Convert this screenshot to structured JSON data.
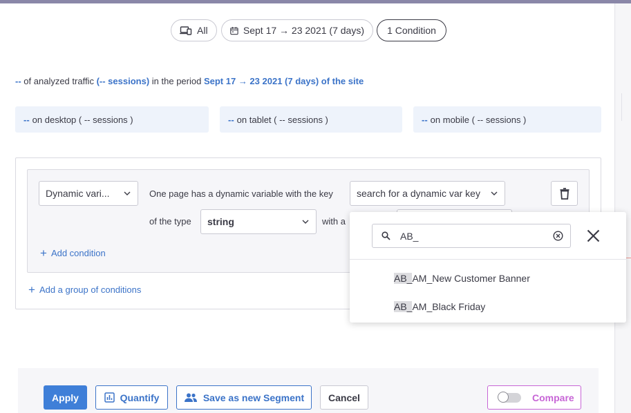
{
  "filters": {
    "device": "All",
    "period": "Sept 17 → 23 2021 (7 days)",
    "conditions": "1 Condition"
  },
  "summary": {
    "value": "--",
    "text1": "of analyzed traffic",
    "sessions": "(-- sessions)",
    "text2": "in the period",
    "period": "Sept 17 → 23 2021 (7 days) of the site"
  },
  "devices": {
    "desktop": {
      "value": "--",
      "label": "on desktop ( -- sessions )"
    },
    "tablet": {
      "value": "--",
      "label": "on tablet ( -- sessions )"
    },
    "mobile": {
      "value": "--",
      "label": "on mobile ( -- sessions )"
    }
  },
  "condition": {
    "dimension": "Dynamic vari...",
    "sentence": "One page has a dynamic variable with the key",
    "key_placeholder": "search for a dynamic var key",
    "type_label": "of the type",
    "type_value": "string",
    "with_label": "with a",
    "add_condition": "Add condition",
    "add_group": "Add a group of conditions"
  },
  "dropdown": {
    "search_value": "AB_",
    "items": [
      {
        "match": "AB_",
        "rest": "AM_New Customer Banner"
      },
      {
        "match": "AB_",
        "rest": "AM_Black Friday"
      }
    ]
  },
  "footer": {
    "apply": "Apply",
    "quantify": "Quantify",
    "save": "Save as new Segment",
    "cancel": "Cancel",
    "compare": "Compare"
  },
  "colors": {
    "accent": "#3f7fd8",
    "link": "#3b73c8",
    "compare": "#c765d6"
  }
}
